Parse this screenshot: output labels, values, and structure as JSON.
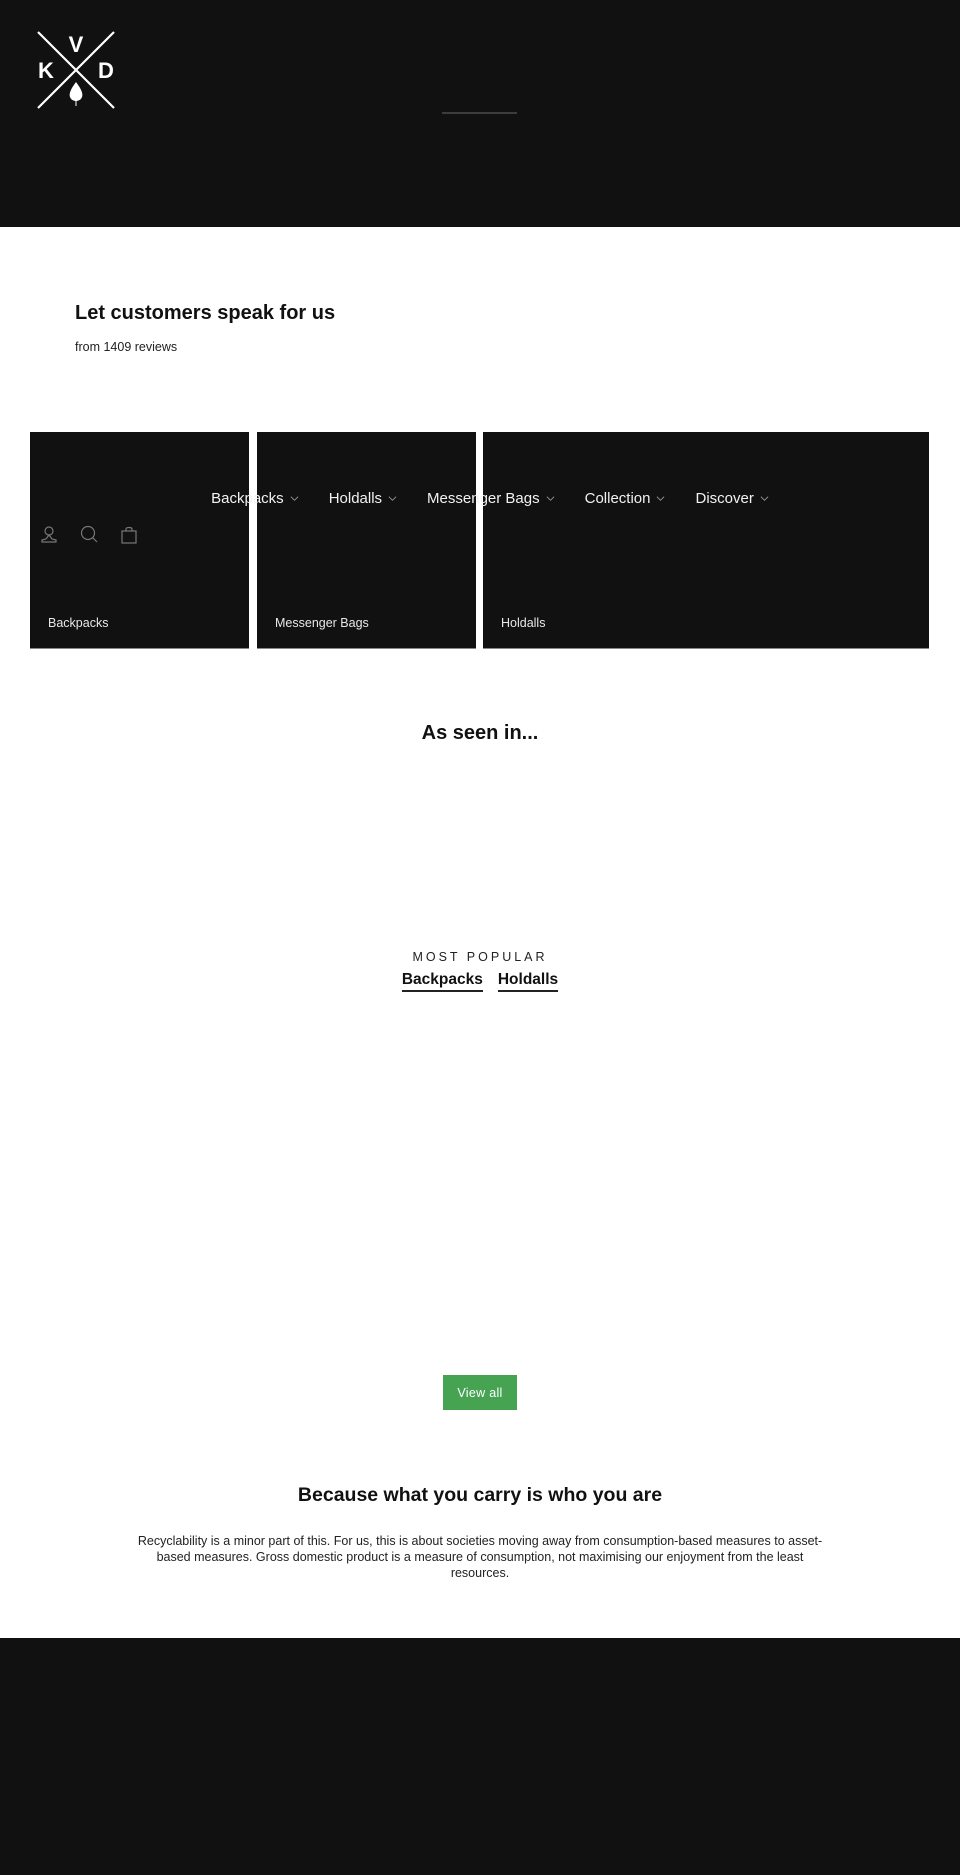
{
  "header": {
    "logo": {
      "letters": [
        "V",
        "K",
        "D"
      ],
      "icon": "kvd-cross-leaf-logo"
    }
  },
  "reviews": {
    "title": "Let customers speak for us",
    "subtitle": "from 1409 reviews"
  },
  "nav": {
    "items": [
      {
        "label": "Backpacks"
      },
      {
        "label": "Holdalls"
      },
      {
        "label": "Messenger Bags"
      },
      {
        "label": "Collection"
      },
      {
        "label": "Discover"
      }
    ],
    "icons": [
      "user-icon",
      "search-icon",
      "cart-bag-icon"
    ]
  },
  "tiles": [
    {
      "caption": "Backpacks"
    },
    {
      "caption": "Messenger Bags"
    },
    {
      "caption": "Holdalls"
    }
  ],
  "seen_in": {
    "title": "As seen in..."
  },
  "popular": {
    "eyebrow": "MOST POPULAR",
    "tabs": [
      {
        "label": "Backpacks"
      },
      {
        "label": "Holdalls"
      }
    ]
  },
  "view_all": {
    "label": "View all",
    "color": "#45a352"
  },
  "because": {
    "title": "Because what you carry is who you are",
    "body": "Recyclability is a minor part of this. For us, this is about societies moving away from consumption-based measures to asset-based measures. Gross domestic product is a measure of consumption, not maximising our enjoyment from the least resources."
  }
}
